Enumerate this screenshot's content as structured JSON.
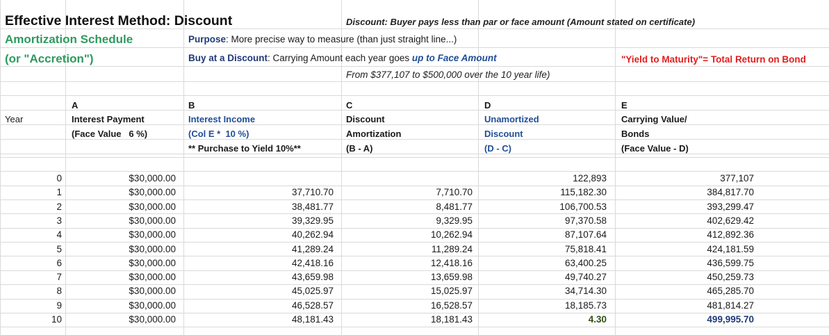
{
  "header": {
    "title": "Effective Interest Method: Discount",
    "subtitle1": "Amortization Schedule",
    "subtitle2": "(or \"Accretion\")",
    "discount_note": "Discount: Buyer pays less than par or face amount (Amount stated on certificate)",
    "purpose_label": "Purpose",
    "purpose_text": ": More precise way to measure (than just straight line...)",
    "buy_label": "Buy at a Discount",
    "buy_text": ": Carrying Amount each year goes ",
    "buy_emph": "up to Face Amount",
    "range_note": "From $377,107 to $500,000 over the 10 year life)",
    "ytm_note": "\"Yield to Maturity\"= Total Return on Bond"
  },
  "columns": {
    "year": "Year",
    "A": {
      "letter": "A",
      "line1": "Interest Payment",
      "line2": "(Face Value   6 %)"
    },
    "B": {
      "letter": "B",
      "line1": "Interest Income",
      "line2": "(Col E *  10 %)",
      "line3": "** Purchase to Yield 10%**"
    },
    "C": {
      "letter": "C",
      "line1": "Discount",
      "line2": "Amortization",
      "line3": "(B - A)"
    },
    "D": {
      "letter": "D",
      "line1": "Unamortized",
      "line2": "Discount",
      "line3": "(D - C)"
    },
    "E": {
      "letter": "E",
      "line1": "Carrying Value/",
      "line2": "Bonds",
      "line3": "(Face Value - D)"
    }
  },
  "rows": [
    {
      "year": "0",
      "a": "$30,000.00",
      "b": "",
      "c": "",
      "d": "122,893",
      "e": "377,107"
    },
    {
      "year": "1",
      "a": "$30,000.00",
      "b": "37,710.70",
      "c": "7,710.70",
      "d": "115,182.30",
      "e": "384,817.70"
    },
    {
      "year": "2",
      "a": "$30,000.00",
      "b": "38,481.77",
      "c": "8,481.77",
      "d": "106,700.53",
      "e": "393,299.47"
    },
    {
      "year": "3",
      "a": "$30,000.00",
      "b": "39,329.95",
      "c": "9,329.95",
      "d": "97,370.58",
      "e": "402,629.42"
    },
    {
      "year": "4",
      "a": "$30,000.00",
      "b": "40,262.94",
      "c": "10,262.94",
      "d": "87,107.64",
      "e": "412,892.36"
    },
    {
      "year": "5",
      "a": "$30,000.00",
      "b": "41,289.24",
      "c": "11,289.24",
      "d": "75,818.41",
      "e": "424,181.59"
    },
    {
      "year": "6",
      "a": "$30,000.00",
      "b": "42,418.16",
      "c": "12,418.16",
      "d": "63,400.25",
      "e": "436,599.75"
    },
    {
      "year": "7",
      "a": "$30,000.00",
      "b": "43,659.98",
      "c": "13,659.98",
      "d": "49,740.27",
      "e": "450,259.73"
    },
    {
      "year": "8",
      "a": "$30,000.00",
      "b": "45,025.97",
      "c": "15,025.97",
      "d": "34,714.30",
      "e": "465,285.70"
    },
    {
      "year": "9",
      "a": "$30,000.00",
      "b": "46,528.57",
      "c": "16,528.57",
      "d": "18,185.73",
      "e": "481,814.27"
    },
    {
      "year": "10",
      "a": "$30,000.00",
      "b": "48,181.43",
      "c": "18,181.43",
      "d": "4.30",
      "e": "499,995.70"
    }
  ],
  "colors": {
    "blue": "#1f4e96",
    "green": "#2e9a5e",
    "red": "#e21d1d",
    "gridline": "#d9d9d9"
  }
}
